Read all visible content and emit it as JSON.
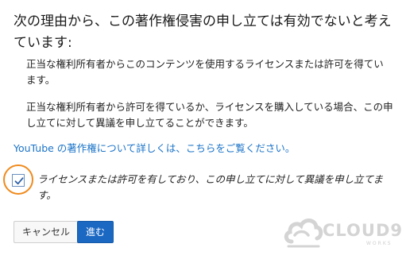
{
  "dialog": {
    "heading": "次の理由から、この著作権侵害の申し立ては有効でないと考えています:",
    "reasons": [
      "正当な権利所有者からこのコンテンツを使用するライセンスまたは許可を得ています。",
      "正当な権利所有者から許可を得ているか、ライセンスを購入している場合、この申し立てに対して異議を申し立てることができます。"
    ],
    "learn_more_link": "YouTube の著作権について詳しくは、こちらをご覧ください。",
    "acknowledgement": {
      "checked": true,
      "label": "ライセンスまたは許可を有しており、この申し立てに対して異議を申し立てます。"
    },
    "buttons": {
      "cancel": "キャンセル",
      "next": "進む"
    }
  },
  "watermark": {
    "text": "CLOUD9",
    "subtext": "WORKS"
  },
  "colors": {
    "link": "#1a73c8",
    "primary_button": "#1b68c3",
    "highlight_ring": "#f08a1c"
  },
  "icons": {
    "checkbox_mark": "check-icon",
    "watermark_logo": "cloud-logo-icon"
  }
}
